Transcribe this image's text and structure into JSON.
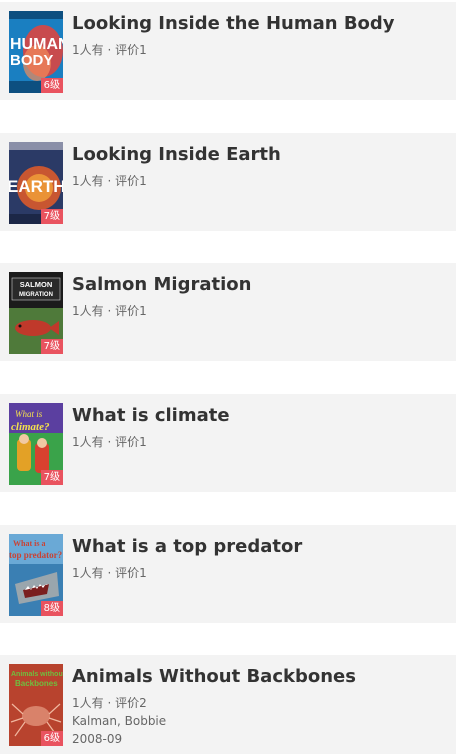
{
  "books": [
    {
      "title": "Looking Inside the Human Body",
      "owners": "1人有",
      "separator": "·",
      "rating": "评价1",
      "level": "6级",
      "cover_text": [
        "HUMAN",
        "BODY"
      ],
      "cover_bg": "#1a7fc1",
      "cover_accent": "#e8423a"
    },
    {
      "title": "Looking Inside Earth",
      "owners": "1人有",
      "separator": "·",
      "rating": "评价1",
      "level": "7级",
      "cover_text": [
        "EARTH"
      ],
      "cover_bg": "#2b3a66",
      "cover_accent": "#d95a2b"
    },
    {
      "title": "Salmon Migration",
      "owners": "1人有",
      "separator": "·",
      "rating": "评价1",
      "level": "7级",
      "cover_text": [
        "SALMON",
        "MIGRATION"
      ],
      "cover_bg": "#1b1b1b",
      "cover_accent": "#c0392b"
    },
    {
      "title": "What is climate",
      "owners": "1人有",
      "separator": "·",
      "rating": "评价1",
      "level": "7级",
      "cover_text": [
        "What is",
        "climate?"
      ],
      "cover_bg": "#5b3fa0",
      "cover_accent": "#3aa34a"
    },
    {
      "title": "What is a top predator",
      "owners": "1人有",
      "separator": "·",
      "rating": "评价1",
      "level": "8级",
      "cover_text": [
        "What is a",
        "top predator?"
      ],
      "cover_bg": "#3a7fb3",
      "cover_accent": "#c94335"
    },
    {
      "title": "Animals Without Backbones",
      "owners": "1人有",
      "separator": "·",
      "rating": "评价2",
      "level": "6级",
      "author": "Kalman, Bobbie",
      "date": "2008-09",
      "cover_text": [
        "Animals without",
        "Backbones"
      ],
      "cover_bg": "#b8432e",
      "cover_accent": "#6fbf3f"
    }
  ]
}
